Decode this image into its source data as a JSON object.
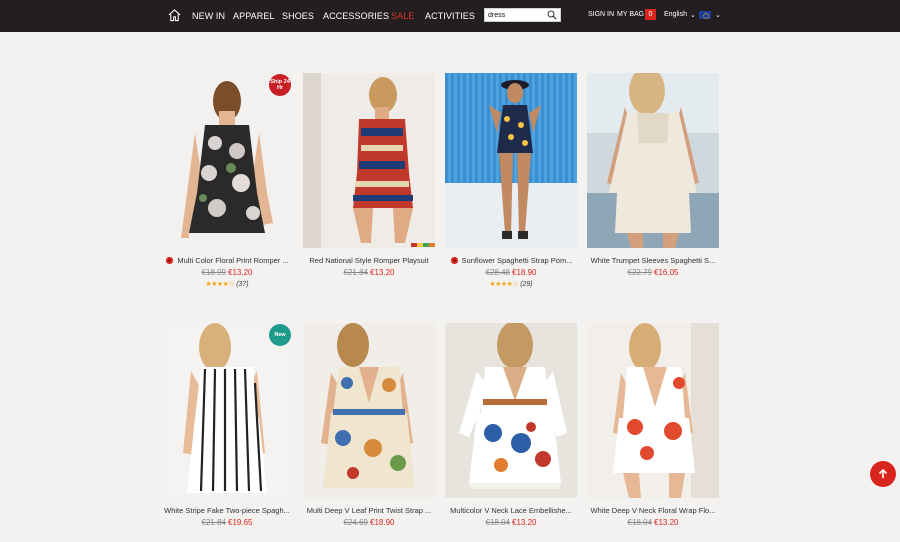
{
  "nav": {
    "links": [
      "NEW IN",
      "APPAREL",
      "SHOES",
      "ACCESSORIES",
      "SALE",
      "ACTIVITIES"
    ],
    "search_value": "dress",
    "sign_in": "SIGN IN",
    "my_bag": "MY BAG",
    "bag_count": "0",
    "language": "English",
    "chevron": "⌄"
  },
  "products": [
    {
      "title": "Multi Color Floral Print Romper ...",
      "old_price": "€18.99",
      "new_price": "€13.20",
      "stars": "★★★★☆",
      "reviews": "(37)",
      "badge": "Ship 24 Hr",
      "flower_icon": true
    },
    {
      "title": "Red National Style Romper Playsuit",
      "old_price": "€21.84",
      "new_price": "€13.20",
      "stars": "",
      "reviews": "",
      "badge": "",
      "flower_icon": false
    },
    {
      "title": "Sunflower Spaghetti Strap Pom...",
      "old_price": "€28.48",
      "new_price": "€18.90",
      "stars": "★★★★☆",
      "reviews": "(29)",
      "badge": "",
      "flower_icon": true
    },
    {
      "title": "White Trumpet Sleeves Spaghetti S...",
      "old_price": "€22.79",
      "new_price": "€16.05",
      "stars": "",
      "reviews": "",
      "badge": "",
      "flower_icon": false
    },
    {
      "title": "White Stripe Fake Two-piece Spagh...",
      "old_price": "€21.84",
      "new_price": "€19.65",
      "stars": "",
      "reviews": "",
      "badge": "New",
      "flower_icon": false
    },
    {
      "title": "Multi Deep V Leaf Print Twist Strap ...",
      "old_price": "€24.69",
      "new_price": "€18.90",
      "stars": "",
      "reviews": "",
      "badge": "",
      "flower_icon": false
    },
    {
      "title": "Multicolor V Neck Lace Embellishe...",
      "old_price": "€18.04",
      "new_price": "€13.20",
      "stars": "",
      "reviews": "",
      "badge": "",
      "flower_icon": false
    },
    {
      "title": "White Deep V Neck Floral Wrap Flo...",
      "old_price": "€18.04",
      "new_price": "€13.20",
      "stars": "",
      "reviews": "",
      "badge": "",
      "flower_icon": false
    }
  ],
  "icons": {
    "home": "home-icon",
    "search": "search-icon",
    "scroll_top": "arrow-up-icon",
    "flower": "rose-icon"
  },
  "colors": {
    "topbar": "#231f20",
    "sale": "#e0342c",
    "price": "#d8261f",
    "star": "#f2a71b",
    "badge_red": "#c81f24",
    "badge_teal": "#1e9a8a"
  }
}
